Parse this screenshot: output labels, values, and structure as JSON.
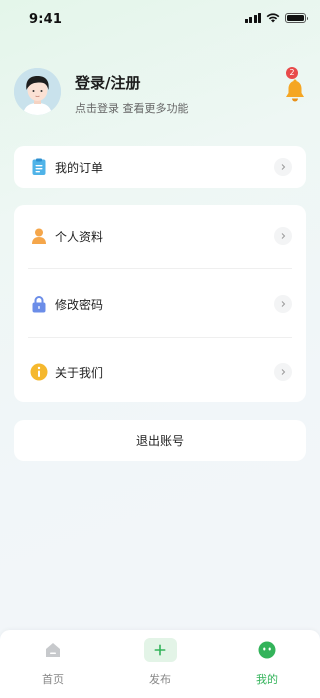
{
  "status_bar": {
    "time": "9:41"
  },
  "profile": {
    "title": "登录/注册",
    "subtitle": "点击登录 查看更多功能",
    "notification_count": "2"
  },
  "orders": {
    "label": "我的订单"
  },
  "menu": {
    "items": [
      {
        "label": "个人资料",
        "icon": "person-icon"
      },
      {
        "label": "修改密码",
        "icon": "lock-icon"
      },
      {
        "label": "关于我们",
        "icon": "info-icon"
      }
    ]
  },
  "logout": {
    "label": "退出账号"
  },
  "tabbar": {
    "tabs": [
      {
        "label": "首页",
        "icon": "home-icon",
        "active": false
      },
      {
        "label": "发布",
        "icon": "plus-icon",
        "active": false
      },
      {
        "label": "我的",
        "icon": "smiley-icon",
        "active": true
      }
    ]
  },
  "colors": {
    "accent": "#33b35a",
    "badge": "#e84a4a",
    "bell": "#f5a623"
  }
}
